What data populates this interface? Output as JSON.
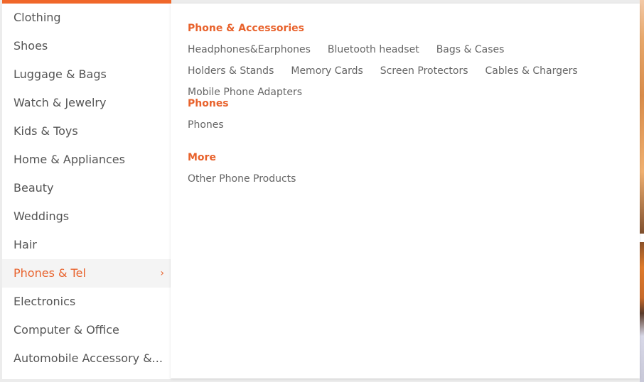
{
  "sidebar": {
    "items": [
      {
        "label": "Clothing"
      },
      {
        "label": "Shoes"
      },
      {
        "label": "Luggage & Bags"
      },
      {
        "label": "Watch & Jewelry"
      },
      {
        "label": "Kids & Toys"
      },
      {
        "label": "Home & Appliances"
      },
      {
        "label": "Beauty"
      },
      {
        "label": "Weddings"
      },
      {
        "label": "Hair"
      },
      {
        "label": "Phones & Tel",
        "active": true
      },
      {
        "label": "Electronics"
      },
      {
        "label": "Computer & Office"
      },
      {
        "label": "Automobile Accessory &..."
      }
    ],
    "active_chevron": "›"
  },
  "panel": {
    "groups": [
      {
        "title": "Phone & Accessories",
        "links": [
          "Headphones&Earphones",
          "Bluetooth headset",
          "Bags & Cases",
          "Holders & Stands",
          "Memory Cards",
          "Screen Protectors",
          "Cables & Chargers",
          "Mobile Phone Adapters"
        ]
      },
      {
        "title": "Phones",
        "links": [
          "Phones"
        ]
      },
      {
        "title": "More",
        "links": [
          "Other Phone Products"
        ]
      }
    ]
  },
  "colors": {
    "accent": "#e8622c",
    "top_bar": "#f0672a",
    "text": "#555555",
    "link": "#666666",
    "active_bg": "#f4f4f4"
  },
  "icons": {
    "chevron": "chevron-right-icon"
  }
}
